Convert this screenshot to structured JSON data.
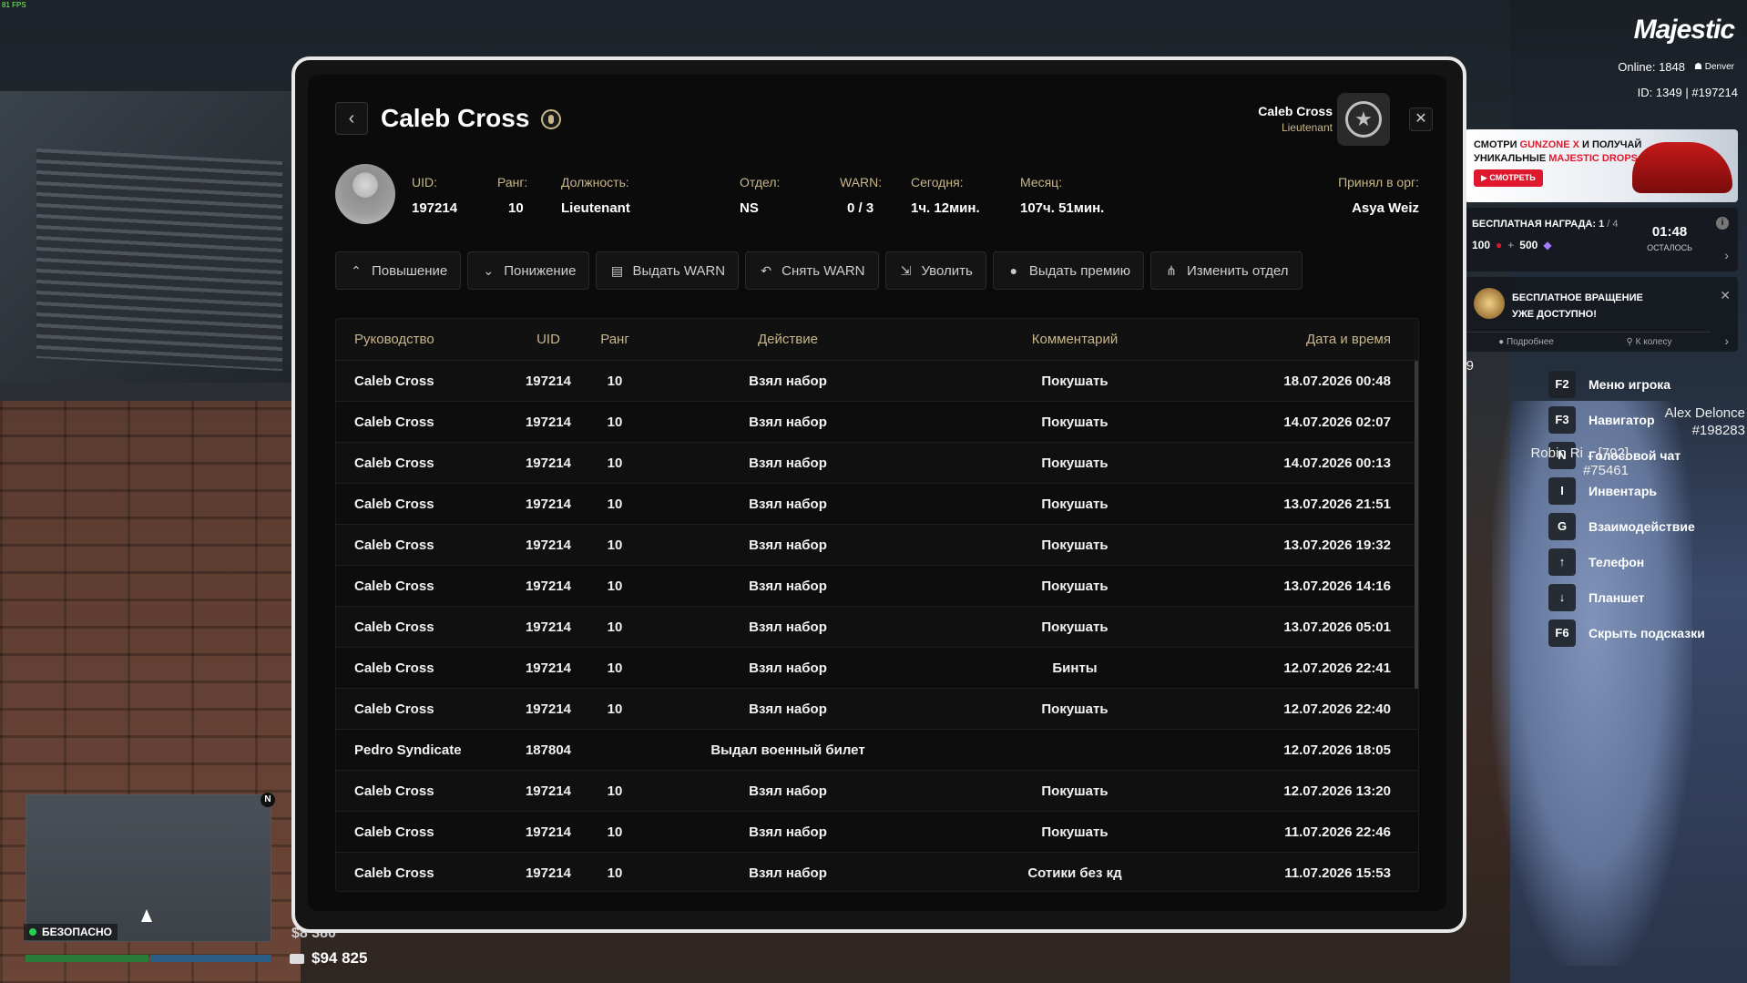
{
  "hud": {
    "fps": "81 FPS",
    "logo": "Majestic",
    "online_label": "Online: 1848",
    "server": "Denver",
    "id_text": "ID: 1349 | #197214",
    "promo": {
      "line1_a": "СМОТРИ ",
      "line1_b": "GUNZONE X",
      "line1_c": " И ПОЛУЧАЙ",
      "line2_a": "УНИКАЛЬНЫЕ ",
      "line2_b": "MAJESTIC DROPS",
      "button": "▶ СМОТРЕТЬ"
    },
    "reward": {
      "title": "БЕСПЛАТНАЯ НАГРАДА: 1",
      "title_of": " / 4",
      "value1": "100",
      "plus": "+",
      "value2": "500",
      "timer": "01:48",
      "timer_label": "ОСТАЛОСЬ"
    },
    "spin": {
      "line1": "БЕСПЛАТНОЕ ВРАЩЕНИЕ",
      "line2": "УЖЕ ДОСТУПНО!",
      "link1": "Подробнее",
      "link2": "К колесу"
    },
    "player_tags": {
      "tag1": "#86879",
      "tag2_name": "Alex Delonce",
      "tag2_id": "#198283",
      "tag3_name": "Robin Ri ...[792]",
      "tag3_id": "#75461"
    },
    "hotkeys": [
      {
        "key": "F2",
        "label": "Меню игрока"
      },
      {
        "key": "F3",
        "label": "Навигатор"
      },
      {
        "key": "N",
        "label": "Голосовой чат"
      },
      {
        "key": "I",
        "label": "Инвентарь"
      },
      {
        "key": "G",
        "label": "Взаимодействие"
      },
      {
        "key": "↑",
        "label": "Телефон"
      },
      {
        "key": "↓",
        "label": "Планшет"
      },
      {
        "key": "F6",
        "label": "Скрыть подсказки"
      }
    ],
    "minimap_north": "N",
    "zone": "БЕЗОПАСНО",
    "money_top": "$8 380",
    "money": "$94 825"
  },
  "modal": {
    "title": "Caleb Cross",
    "header_user_name": "Caleb Cross",
    "header_user_rank": "Lieutenant",
    "info": {
      "uid_label": "UID:",
      "uid": "197214",
      "rank_label": "Ранг:",
      "rank": "10",
      "position_label": "Должность:",
      "position": "Lieutenant",
      "dept_label": "Отдел:",
      "dept": "NS",
      "warn_label": "WARN:",
      "warn": "0 / 3",
      "today_label": "Сегодня:",
      "today": "1ч. 12мин.",
      "month_label": "Месяц:",
      "month": "107ч. 51мин.",
      "accepted_label": "Принял в орг:",
      "accepted": "Asya Weiz"
    },
    "actions": [
      {
        "icon": "chevrons-up-icon",
        "glyph": "⌃",
        "label": "Повышение"
      },
      {
        "icon": "chevrons-down-icon",
        "glyph": "⌄",
        "label": "Понижение"
      },
      {
        "icon": "document-warn-icon",
        "glyph": "▤",
        "label": "Выдать WARN"
      },
      {
        "icon": "undo-icon",
        "glyph": "↶",
        "label": "Снять WARN"
      },
      {
        "icon": "person-exit-icon",
        "glyph": "⇲",
        "label": "Уволить"
      },
      {
        "icon": "coin-icon",
        "glyph": "●",
        "label": "Выдать премию"
      },
      {
        "icon": "org-chart-icon",
        "glyph": "⋔",
        "label": "Изменить отдел"
      }
    ],
    "table": {
      "headers": [
        "Руководство",
        "UID",
        "Ранг",
        "Действие",
        "Комментарий",
        "Дата и время"
      ],
      "rows": [
        [
          "Caleb Cross",
          "197214",
          "10",
          "Взял набор",
          "Покушать",
          "18.07.2026 00:48"
        ],
        [
          "Caleb Cross",
          "197214",
          "10",
          "Взял набор",
          "Покушать",
          "14.07.2026 02:07"
        ],
        [
          "Caleb Cross",
          "197214",
          "10",
          "Взял набор",
          "Покушать",
          "14.07.2026 00:13"
        ],
        [
          "Caleb Cross",
          "197214",
          "10",
          "Взял набор",
          "Покушать",
          "13.07.2026 21:51"
        ],
        [
          "Caleb Cross",
          "197214",
          "10",
          "Взял набор",
          "Покушать",
          "13.07.2026 19:32"
        ],
        [
          "Caleb Cross",
          "197214",
          "10",
          "Взял набор",
          "Покушать",
          "13.07.2026 14:16"
        ],
        [
          "Caleb Cross",
          "197214",
          "10",
          "Взял набор",
          "Покушать",
          "13.07.2026 05:01"
        ],
        [
          "Caleb Cross",
          "197214",
          "10",
          "Взял набор",
          "Бинты",
          "12.07.2026 22:41"
        ],
        [
          "Caleb Cross",
          "197214",
          "10",
          "Взял набор",
          "Покушать",
          "12.07.2026 22:40"
        ],
        [
          "Pedro Syndicate",
          "187804",
          "",
          "Выдал военный билет",
          "",
          "12.07.2026 18:05"
        ],
        [
          "Caleb Cross",
          "197214",
          "10",
          "Взял набор",
          "Покушать",
          "12.07.2026 13:20"
        ],
        [
          "Caleb Cross",
          "197214",
          "10",
          "Взял набор",
          "Покушать",
          "11.07.2026 22:46"
        ],
        [
          "Caleb Cross",
          "197214",
          "10",
          "Взял набор",
          "Сотики без кд",
          "11.07.2026 15:53"
        ]
      ]
    }
  }
}
